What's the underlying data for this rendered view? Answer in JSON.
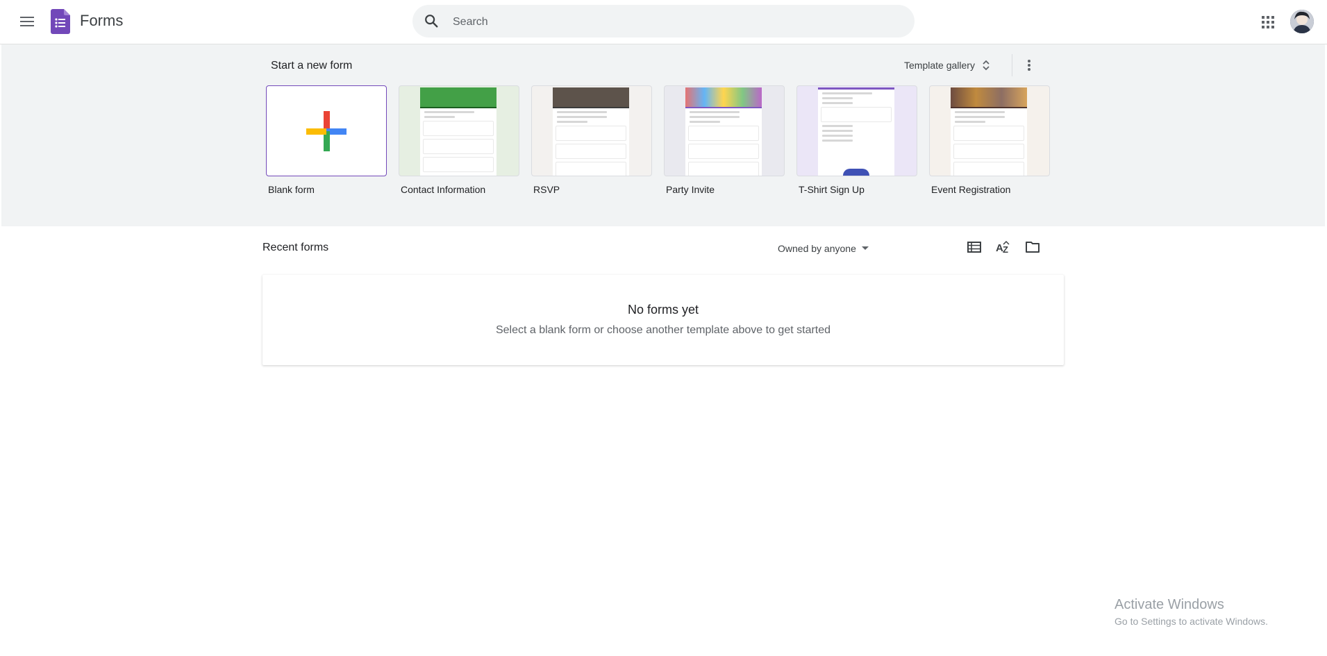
{
  "header": {
    "app_title": "Forms",
    "search_placeholder": "Search",
    "icons": {
      "menu": "hamburger-menu-icon",
      "logo": "forms-logo-icon",
      "search": "search-icon",
      "apps": "apps-grid-icon"
    },
    "brand_color": "#7248b9"
  },
  "templates": {
    "section_title": "Start a new form",
    "gallery_label": "Template gallery",
    "items": [
      {
        "label": "Blank form"
      },
      {
        "label": "Contact Information",
        "accent": "#2e7d32",
        "bg": "#e6efe2"
      },
      {
        "label": "RSVP",
        "accent": "#5f6368",
        "bg": "#f3f1ef"
      },
      {
        "label": "Party Invite",
        "accent": "#7e57c2",
        "bg": "#e9e9ef"
      },
      {
        "label": "T-Shirt Sign Up",
        "accent": "#7e57c2",
        "bg": "#ebe6f7"
      },
      {
        "label": "Event Registration",
        "accent": "#8d5a2b",
        "bg": "#f5f1ec"
      }
    ]
  },
  "recent": {
    "title": "Recent forms",
    "owner_filter": "Owned by anyone",
    "view_icons": [
      "list-view-icon",
      "sort-az-icon",
      "folder-icon"
    ],
    "empty_title": "No forms yet",
    "empty_subtitle": "Select a blank form or choose another template above to get started"
  },
  "watermark": {
    "line1": "Activate Windows",
    "line2": "Go to Settings to activate Windows."
  }
}
